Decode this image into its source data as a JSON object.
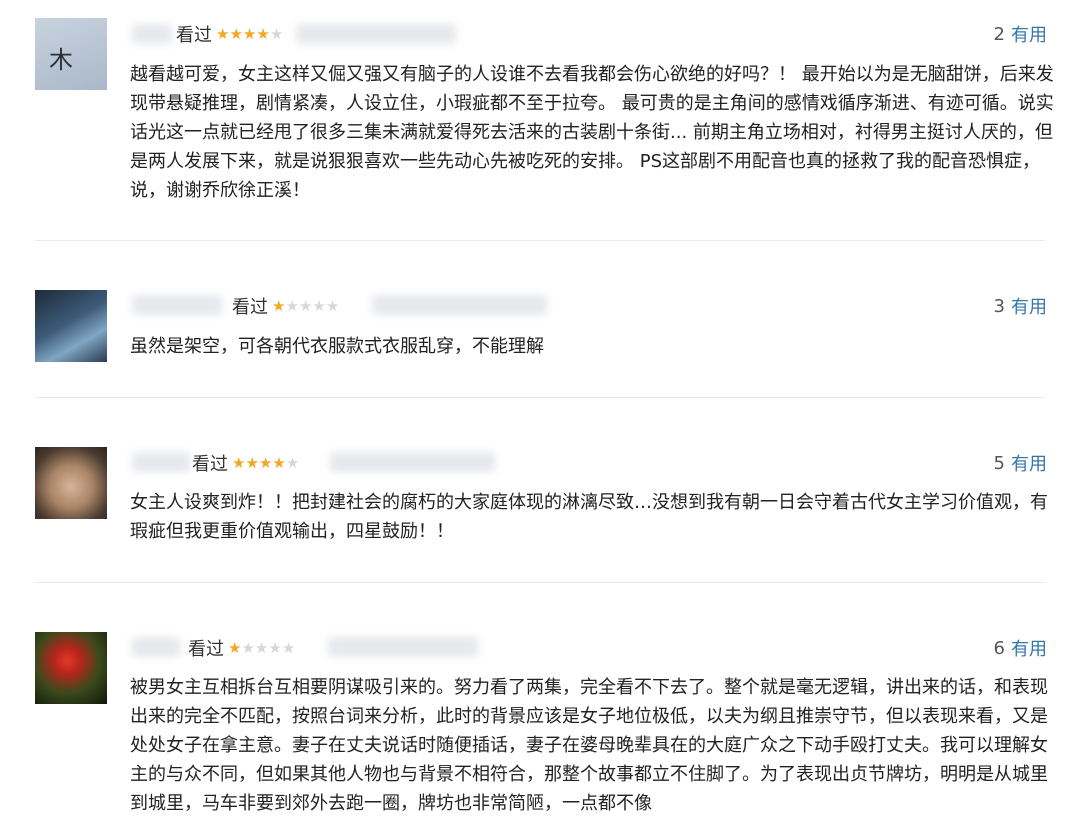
{
  "reviews": [
    {
      "watched": "看过",
      "rating": 4,
      "useful_count": "2",
      "useful_label": "有用",
      "avatar_text": "木",
      "text": "越看越可爱，女主这样又倔又强又有脑子的人设谁不去看我都会伤心欲绝的好吗？！ 最开始以为是无脑甜饼，后来发现带悬疑推理，剧情紧凑，人设立住，小瑕疵都不至于拉夸。 最可贵的是主角间的感情戏循序渐进、有迹可循。说实话光这一点就已经甩了很多三集未满就爱得死去活来的古装剧十条街... 前期主角立场相对，衬得男主挺讨人厌的，但是两人发展下来，就是说狠狠喜欢一些先动心先被吃死的安排。 PS这部剧不用配音也真的拯救了我的配音恐惧症，说，谢谢乔欣徐正溪！"
    },
    {
      "watched": "看过",
      "rating": 1,
      "useful_count": "3",
      "useful_label": "有用",
      "text": "虽然是架空，可各朝代衣服款式衣服乱穿，不能理解"
    },
    {
      "watched": "看过",
      "rating": 4,
      "useful_count": "5",
      "useful_label": "有用",
      "text": "女主人设爽到炸！！把封建社会的腐朽的大家庭体现的淋漓尽致…没想到我有朝一日会守着古代女主学习价值观，有瑕疵但我更重价值观输出，四星鼓励！！"
    },
    {
      "watched": "看过",
      "rating": 1,
      "useful_count": "6",
      "useful_label": "有用",
      "text": "被男女主互相拆台互相要阴谋吸引来的。努力看了两集，完全看不下去了。整个就是毫无逻辑，讲出来的话，和表现出来的完全不匹配，按照台词来分析，此时的背景应该是女子地位极低，以夫为纲且推崇守节，但以表现来看，又是处处女子在拿主意。妻子在丈夫说话时随便插话，妻子在婆母晚辈具在的大庭广众之下动手殴打丈夫。我可以理解女主的与众不同，但如果其他人物也与背景不相符合，那整个故事都立不住脚了。为了表现出贞节牌坊，明明是从城里到城里，马车非要到郊外去跑一圈，牌坊也非常简陋，一点都不像"
    }
  ],
  "colors": {
    "star_on": "#f5a623",
    "star_off": "#d8d8d8",
    "link": "#3377aa"
  }
}
